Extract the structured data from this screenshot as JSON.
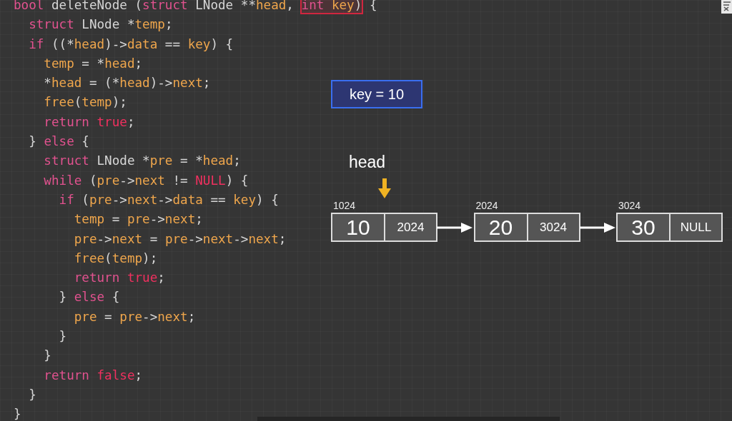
{
  "code": {
    "lines": [
      {
        "tokens": [
          {
            "kind": "kw",
            "text": "bool"
          },
          {
            "kind": "pl",
            "text": " deleteNode ("
          },
          {
            "kind": "kw",
            "text": "struct"
          },
          {
            "kind": "pl",
            "text": " LNode **"
          },
          {
            "kind": "id",
            "text": "head"
          },
          {
            "kind": "pl",
            "text": ", "
          }
        ],
        "highlight": [
          {
            "kind": "kw",
            "text": "int"
          },
          {
            "kind": "id",
            "text": " key"
          },
          {
            "kind": "pl",
            "text": ")"
          }
        ],
        "after": [
          {
            "kind": "pl",
            "text": " {"
          }
        ]
      },
      {
        "tokens": [
          {
            "kind": "kw",
            "text": "  struct"
          },
          {
            "kind": "pl",
            "text": " LNode *"
          },
          {
            "kind": "id",
            "text": "temp"
          },
          {
            "kind": "pl",
            "text": ";"
          }
        ]
      },
      {
        "tokens": [
          {
            "kind": "kw",
            "text": "  if"
          },
          {
            "kind": "pl",
            "text": " ((*"
          },
          {
            "kind": "id",
            "text": "head"
          },
          {
            "kind": "pl",
            "text": ")->"
          },
          {
            "kind": "id",
            "text": "data"
          },
          {
            "kind": "pl",
            "text": " == "
          },
          {
            "kind": "id",
            "text": "key"
          },
          {
            "kind": "pl",
            "text": ") {"
          }
        ]
      },
      {
        "tokens": [
          {
            "kind": "id",
            "text": "    temp"
          },
          {
            "kind": "pl",
            "text": " = *"
          },
          {
            "kind": "id",
            "text": "head"
          },
          {
            "kind": "pl",
            "text": ";"
          }
        ]
      },
      {
        "tokens": [
          {
            "kind": "pl",
            "text": "    *"
          },
          {
            "kind": "id",
            "text": "head"
          },
          {
            "kind": "pl",
            "text": " = (*"
          },
          {
            "kind": "id",
            "text": "head"
          },
          {
            "kind": "pl",
            "text": ")->"
          },
          {
            "kind": "id",
            "text": "next"
          },
          {
            "kind": "pl",
            "text": ";"
          }
        ]
      },
      {
        "tokens": [
          {
            "kind": "id",
            "text": "    free"
          },
          {
            "kind": "pl",
            "text": "("
          },
          {
            "kind": "id",
            "text": "temp"
          },
          {
            "kind": "pl",
            "text": ");"
          }
        ]
      },
      {
        "tokens": [
          {
            "kind": "kw",
            "text": "    return"
          },
          {
            "kind": "lit",
            "text": " true"
          },
          {
            "kind": "pl",
            "text": ";"
          }
        ]
      },
      {
        "tokens": [
          {
            "kind": "pl",
            "text": "  } "
          },
          {
            "kind": "kw",
            "text": "else"
          },
          {
            "kind": "pl",
            "text": " {"
          }
        ]
      },
      {
        "tokens": [
          {
            "kind": "kw",
            "text": "    struct"
          },
          {
            "kind": "pl",
            "text": " LNode *"
          },
          {
            "kind": "id",
            "text": "pre"
          },
          {
            "kind": "pl",
            "text": " = *"
          },
          {
            "kind": "id",
            "text": "head"
          },
          {
            "kind": "pl",
            "text": ";"
          }
        ]
      },
      {
        "tokens": [
          {
            "kind": "kw",
            "text": "    while"
          },
          {
            "kind": "pl",
            "text": " ("
          },
          {
            "kind": "id",
            "text": "pre"
          },
          {
            "kind": "pl",
            "text": "->"
          },
          {
            "kind": "id",
            "text": "next"
          },
          {
            "kind": "pl",
            "text": " != "
          },
          {
            "kind": "lit",
            "text": "NULL"
          },
          {
            "kind": "pl",
            "text": ") {"
          }
        ]
      },
      {
        "tokens": [
          {
            "kind": "kw",
            "text": "      if"
          },
          {
            "kind": "pl",
            "text": " ("
          },
          {
            "kind": "id",
            "text": "pre"
          },
          {
            "kind": "pl",
            "text": "->"
          },
          {
            "kind": "id",
            "text": "next"
          },
          {
            "kind": "pl",
            "text": "->"
          },
          {
            "kind": "id",
            "text": "data"
          },
          {
            "kind": "pl",
            "text": " == "
          },
          {
            "kind": "id",
            "text": "key"
          },
          {
            "kind": "pl",
            "text": ") {"
          }
        ]
      },
      {
        "tokens": [
          {
            "kind": "id",
            "text": "        temp"
          },
          {
            "kind": "pl",
            "text": " = "
          },
          {
            "kind": "id",
            "text": "pre"
          },
          {
            "kind": "pl",
            "text": "->"
          },
          {
            "kind": "id",
            "text": "next"
          },
          {
            "kind": "pl",
            "text": ";"
          }
        ]
      },
      {
        "tokens": [
          {
            "kind": "id",
            "text": "        pre"
          },
          {
            "kind": "pl",
            "text": "->"
          },
          {
            "kind": "id",
            "text": "next"
          },
          {
            "kind": "pl",
            "text": " = "
          },
          {
            "kind": "id",
            "text": "pre"
          },
          {
            "kind": "pl",
            "text": "->"
          },
          {
            "kind": "id",
            "text": "next"
          },
          {
            "kind": "pl",
            "text": "->"
          },
          {
            "kind": "id",
            "text": "next"
          },
          {
            "kind": "pl",
            "text": ";"
          }
        ]
      },
      {
        "tokens": [
          {
            "kind": "id",
            "text": "        free"
          },
          {
            "kind": "pl",
            "text": "("
          },
          {
            "kind": "id",
            "text": "temp"
          },
          {
            "kind": "pl",
            "text": ");"
          }
        ]
      },
      {
        "tokens": [
          {
            "kind": "kw",
            "text": "        return"
          },
          {
            "kind": "lit",
            "text": " true"
          },
          {
            "kind": "pl",
            "text": ";"
          }
        ]
      },
      {
        "tokens": [
          {
            "kind": "pl",
            "text": "      } "
          },
          {
            "kind": "kw",
            "text": "else"
          },
          {
            "kind": "pl",
            "text": " {"
          }
        ]
      },
      {
        "tokens": [
          {
            "kind": "id",
            "text": "        pre"
          },
          {
            "kind": "pl",
            "text": " = "
          },
          {
            "kind": "id",
            "text": "pre"
          },
          {
            "kind": "pl",
            "text": "->"
          },
          {
            "kind": "id",
            "text": "next"
          },
          {
            "kind": "pl",
            "text": ";"
          }
        ]
      },
      {
        "tokens": [
          {
            "kind": "pl",
            "text": "      }"
          }
        ]
      },
      {
        "tokens": [
          {
            "kind": "pl",
            "text": "    }"
          }
        ]
      },
      {
        "tokens": [
          {
            "kind": "kw",
            "text": "    return"
          },
          {
            "kind": "lit",
            "text": " false"
          },
          {
            "kind": "pl",
            "text": ";"
          }
        ]
      },
      {
        "tokens": [
          {
            "kind": "pl",
            "text": "  }"
          }
        ]
      },
      {
        "tokens": [
          {
            "kind": "pl",
            "text": "}"
          }
        ]
      }
    ]
  },
  "diagram": {
    "key_box": "key = 10",
    "head_label": "head",
    "nodes": [
      {
        "address": "1024",
        "data": "10",
        "next": "2024",
        "head": true
      },
      {
        "address": "2024",
        "data": "20",
        "next": "3024",
        "head": false
      },
      {
        "address": "3024",
        "data": "30",
        "next": "NULL",
        "head": false
      }
    ]
  }
}
